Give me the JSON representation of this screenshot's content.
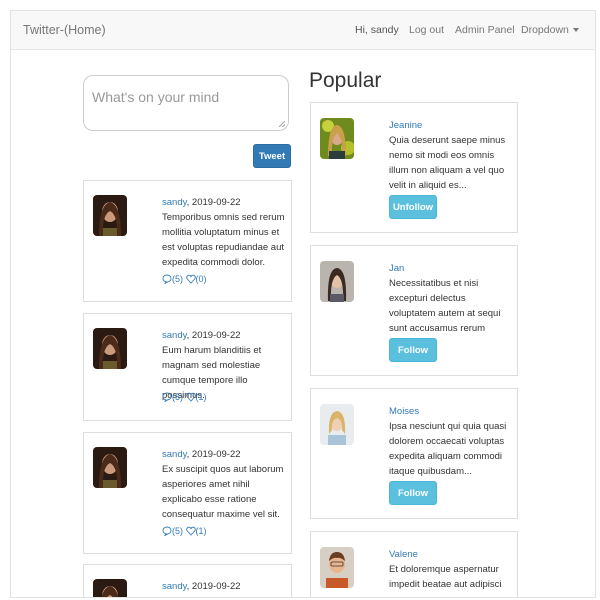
{
  "navbar": {
    "brand": "Twitter-(Home)",
    "greeting": "Hi, sandy",
    "logout": "Log out",
    "admin": "Admin Panel",
    "dropdown": "Dropdown"
  },
  "compose": {
    "placeholder": "What's on your mind",
    "tweet_label": "Tweet"
  },
  "feed": [
    {
      "user": "sandy",
      "date": ", 2019-09-22",
      "text": "Temporibus omnis sed rerum mollitia voluptatum minus et est voluptas repudiandae aut expedita commodi dolor.",
      "comments": "(5)",
      "likes": "(0)"
    },
    {
      "user": "sandy",
      "date": ", 2019-09-22",
      "text": "Eum harum blanditiis et magnam sed molestiae cumque tempore illo possimus.",
      "comments": "(5)",
      "likes": "(1)"
    },
    {
      "user": "sandy",
      "date": ", 2019-09-22",
      "text": "Ex suscipit quos aut laborum asperiores amet nihil explicabo esse ratione consequatur maxime vel sit.",
      "comments": "(5)",
      "likes": "(1)"
    },
    {
      "user": "sandy",
      "date": ", 2019-09-22"
    }
  ],
  "popular": {
    "title": "Popular",
    "users": [
      {
        "name": "Jeanine",
        "text": "Quia deserunt saepe minus nemo sit modi eos omnis illum non aliquam a vel quo velit in aliquid es...",
        "button": "Unfollow"
      },
      {
        "name": "Jan",
        "text": "Necessitatibus et nisi excepturi delectus voluptatem autem at sequi sunt accusamus rerum repellat...",
        "button": "Follow"
      },
      {
        "name": "Moises",
        "text": "Ipsa nesciunt qui quia quasi dolorem occaecati voluptas expedita aliquam commodi itaque quibusdam...",
        "button": "Follow"
      },
      {
        "name": "Valene",
        "text": "Et doloremque aspernatur impedit beatae aut adipisci"
      }
    ]
  }
}
